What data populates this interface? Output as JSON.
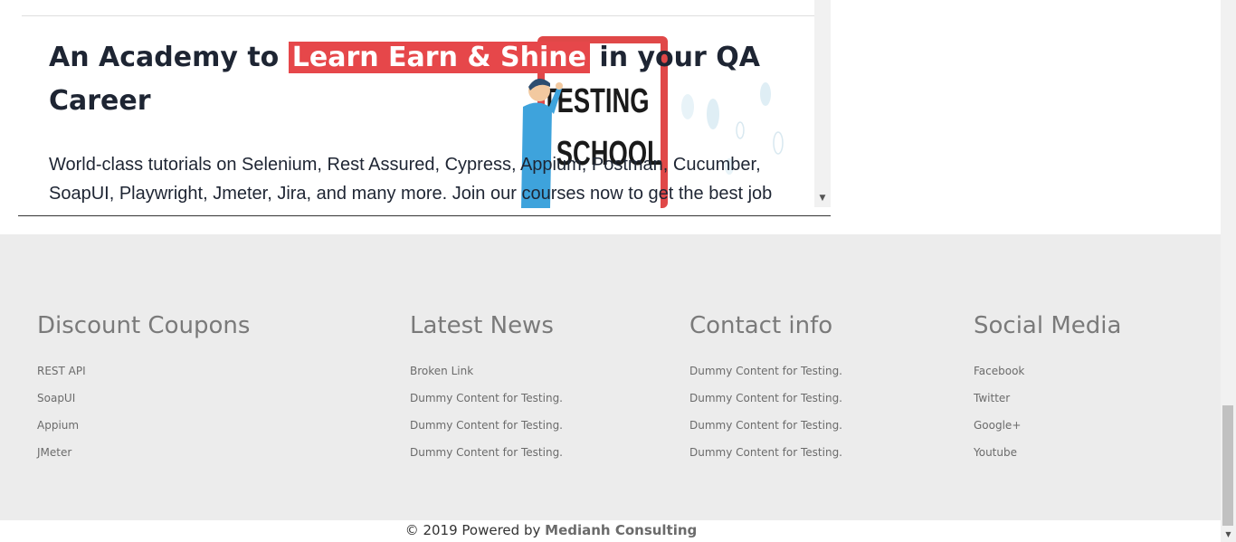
{
  "hero": {
    "title_before": "An Academy to",
    "title_highlight": "Learn Earn & Shine",
    "title_after": "in your QA Career",
    "description": "World-class tutorials on Selenium, Rest Assured, Cypress, Appium, Postman, Cucumber, SoapUI, Playwright, Jmeter, Jira, and many more. Join our courses now to get the best job",
    "image_text_line1": "TESTING",
    "image_text_line2": "SCHOOL",
    "highlight_color": "#e6474a"
  },
  "iframe_scrollbar": {
    "down_arrow": "▼"
  },
  "footer": {
    "columns": [
      {
        "heading": "Discount Coupons",
        "links": [
          "REST API",
          "SoapUI",
          "Appium",
          "JMeter"
        ]
      },
      {
        "heading": "Latest News",
        "links": [
          "Broken Link",
          "Dummy Content for Testing.",
          "Dummy Content for Testing.",
          "Dummy Content for Testing."
        ]
      },
      {
        "heading": "Contact info",
        "links": [
          "Dummy Content for Testing.",
          "Dummy Content for Testing.",
          "Dummy Content for Testing.",
          "Dummy Content for Testing."
        ]
      },
      {
        "heading": "Social Media",
        "links": [
          "Facebook",
          "Twitter",
          "Google+",
          "Youtube"
        ]
      }
    ],
    "copyright_prefix": "© 2019 Powered by",
    "copyright_brand": "Medianh Consulting",
    "background_color": "#ececec"
  },
  "page_scrollbar": {
    "down_arrow": "▼"
  }
}
